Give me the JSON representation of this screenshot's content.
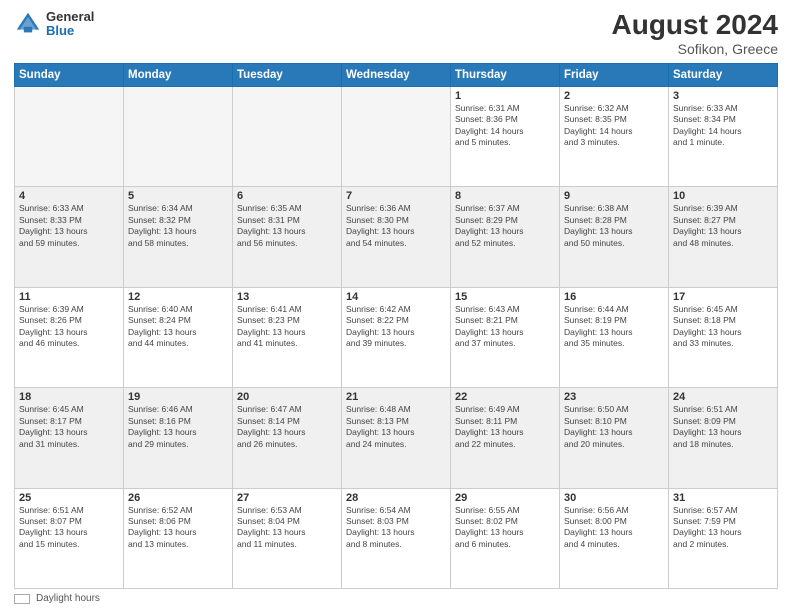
{
  "header": {
    "logo": {
      "general": "General",
      "blue": "Blue"
    },
    "title": "August 2024",
    "location": "Sofikon, Greece"
  },
  "days_of_week": [
    "Sunday",
    "Monday",
    "Tuesday",
    "Wednesday",
    "Thursday",
    "Friday",
    "Saturday"
  ],
  "weeks": [
    [
      {
        "day": "",
        "info": ""
      },
      {
        "day": "",
        "info": ""
      },
      {
        "day": "",
        "info": ""
      },
      {
        "day": "",
        "info": ""
      },
      {
        "day": "1",
        "info": "Sunrise: 6:31 AM\nSunset: 8:36 PM\nDaylight: 14 hours\nand 5 minutes."
      },
      {
        "day": "2",
        "info": "Sunrise: 6:32 AM\nSunset: 8:35 PM\nDaylight: 14 hours\nand 3 minutes."
      },
      {
        "day": "3",
        "info": "Sunrise: 6:33 AM\nSunset: 8:34 PM\nDaylight: 14 hours\nand 1 minute."
      }
    ],
    [
      {
        "day": "4",
        "info": "Sunrise: 6:33 AM\nSunset: 8:33 PM\nDaylight: 13 hours\nand 59 minutes."
      },
      {
        "day": "5",
        "info": "Sunrise: 6:34 AM\nSunset: 8:32 PM\nDaylight: 13 hours\nand 58 minutes."
      },
      {
        "day": "6",
        "info": "Sunrise: 6:35 AM\nSunset: 8:31 PM\nDaylight: 13 hours\nand 56 minutes."
      },
      {
        "day": "7",
        "info": "Sunrise: 6:36 AM\nSunset: 8:30 PM\nDaylight: 13 hours\nand 54 minutes."
      },
      {
        "day": "8",
        "info": "Sunrise: 6:37 AM\nSunset: 8:29 PM\nDaylight: 13 hours\nand 52 minutes."
      },
      {
        "day": "9",
        "info": "Sunrise: 6:38 AM\nSunset: 8:28 PM\nDaylight: 13 hours\nand 50 minutes."
      },
      {
        "day": "10",
        "info": "Sunrise: 6:39 AM\nSunset: 8:27 PM\nDaylight: 13 hours\nand 48 minutes."
      }
    ],
    [
      {
        "day": "11",
        "info": "Sunrise: 6:39 AM\nSunset: 8:26 PM\nDaylight: 13 hours\nand 46 minutes."
      },
      {
        "day": "12",
        "info": "Sunrise: 6:40 AM\nSunset: 8:24 PM\nDaylight: 13 hours\nand 44 minutes."
      },
      {
        "day": "13",
        "info": "Sunrise: 6:41 AM\nSunset: 8:23 PM\nDaylight: 13 hours\nand 41 minutes."
      },
      {
        "day": "14",
        "info": "Sunrise: 6:42 AM\nSunset: 8:22 PM\nDaylight: 13 hours\nand 39 minutes."
      },
      {
        "day": "15",
        "info": "Sunrise: 6:43 AM\nSunset: 8:21 PM\nDaylight: 13 hours\nand 37 minutes."
      },
      {
        "day": "16",
        "info": "Sunrise: 6:44 AM\nSunset: 8:19 PM\nDaylight: 13 hours\nand 35 minutes."
      },
      {
        "day": "17",
        "info": "Sunrise: 6:45 AM\nSunset: 8:18 PM\nDaylight: 13 hours\nand 33 minutes."
      }
    ],
    [
      {
        "day": "18",
        "info": "Sunrise: 6:45 AM\nSunset: 8:17 PM\nDaylight: 13 hours\nand 31 minutes."
      },
      {
        "day": "19",
        "info": "Sunrise: 6:46 AM\nSunset: 8:16 PM\nDaylight: 13 hours\nand 29 minutes."
      },
      {
        "day": "20",
        "info": "Sunrise: 6:47 AM\nSunset: 8:14 PM\nDaylight: 13 hours\nand 26 minutes."
      },
      {
        "day": "21",
        "info": "Sunrise: 6:48 AM\nSunset: 8:13 PM\nDaylight: 13 hours\nand 24 minutes."
      },
      {
        "day": "22",
        "info": "Sunrise: 6:49 AM\nSunset: 8:11 PM\nDaylight: 13 hours\nand 22 minutes."
      },
      {
        "day": "23",
        "info": "Sunrise: 6:50 AM\nSunset: 8:10 PM\nDaylight: 13 hours\nand 20 minutes."
      },
      {
        "day": "24",
        "info": "Sunrise: 6:51 AM\nSunset: 8:09 PM\nDaylight: 13 hours\nand 18 minutes."
      }
    ],
    [
      {
        "day": "25",
        "info": "Sunrise: 6:51 AM\nSunset: 8:07 PM\nDaylight: 13 hours\nand 15 minutes."
      },
      {
        "day": "26",
        "info": "Sunrise: 6:52 AM\nSunset: 8:06 PM\nDaylight: 13 hours\nand 13 minutes."
      },
      {
        "day": "27",
        "info": "Sunrise: 6:53 AM\nSunset: 8:04 PM\nDaylight: 13 hours\nand 11 minutes."
      },
      {
        "day": "28",
        "info": "Sunrise: 6:54 AM\nSunset: 8:03 PM\nDaylight: 13 hours\nand 8 minutes."
      },
      {
        "day": "29",
        "info": "Sunrise: 6:55 AM\nSunset: 8:02 PM\nDaylight: 13 hours\nand 6 minutes."
      },
      {
        "day": "30",
        "info": "Sunrise: 6:56 AM\nSunset: 8:00 PM\nDaylight: 13 hours\nand 4 minutes."
      },
      {
        "day": "31",
        "info": "Sunrise: 6:57 AM\nSunset: 7:59 PM\nDaylight: 13 hours\nand 2 minutes."
      }
    ]
  ],
  "footer": {
    "legend_label": "Daylight hours"
  }
}
